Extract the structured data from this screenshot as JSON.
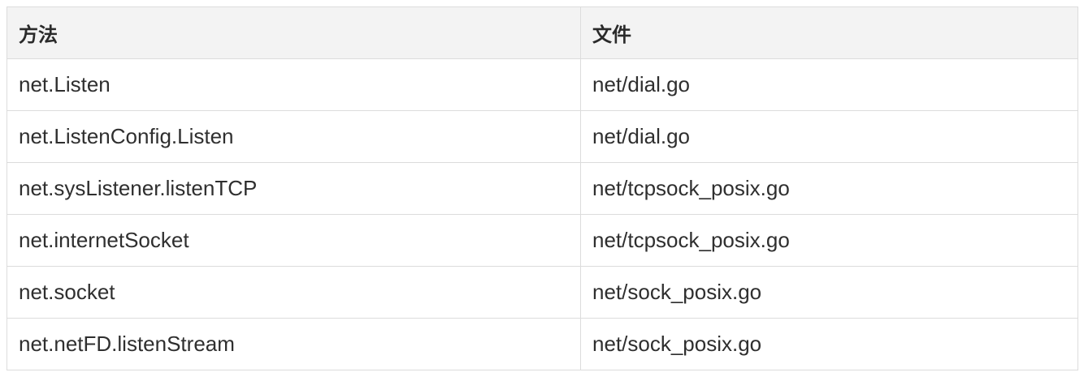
{
  "table": {
    "headers": [
      "方法",
      "文件"
    ],
    "rows": [
      [
        "net.Listen",
        "net/dial.go"
      ],
      [
        "net.ListenConfig.Listen",
        "net/dial.go"
      ],
      [
        "net.sysListener.listenTCP",
        "net/tcpsock_posix.go"
      ],
      [
        "net.internetSocket",
        "net/tcpsock_posix.go"
      ],
      [
        "net.socket",
        "net/sock_posix.go"
      ],
      [
        "net.netFD.listenStream",
        "net/sock_posix.go"
      ]
    ]
  }
}
